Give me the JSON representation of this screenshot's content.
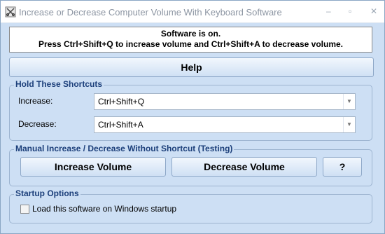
{
  "window": {
    "title": "Increase or Decrease Computer Volume With Keyboard Software",
    "minimize_glyph": "–",
    "maximize_glyph": "▫",
    "close_glyph": "✕"
  },
  "status": {
    "line1": "Software is on.",
    "line2": "Press Ctrl+Shift+Q to increase volume and Ctrl+Shift+A to decrease volume."
  },
  "help_label": "Help",
  "shortcuts": {
    "group_title": "Hold These Shortcuts",
    "increase_label": "Increase:",
    "increase_value": "Ctrl+Shift+Q",
    "decrease_label": "Decrease:",
    "decrease_value": "Ctrl+Shift+A"
  },
  "manual": {
    "group_title": "Manual Increase / Decrease Without Shortcut (Testing)",
    "increase_button": "Increase Volume",
    "decrease_button": "Decrease Volume",
    "question_button": "?"
  },
  "startup": {
    "group_title": "Startup Options",
    "checkbox_label": "Load this software on Windows startup",
    "checked": false
  },
  "colors": {
    "window_bg": "#cddff4",
    "group_title": "#1c3f7a",
    "button_border": "#8ea8c8"
  },
  "icons": {
    "app": "app-scissors-icon",
    "dropdown": "chevron-down-icon"
  }
}
